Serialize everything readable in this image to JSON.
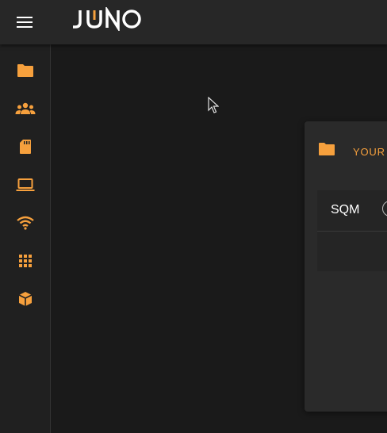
{
  "app": {
    "logo_text": "JUNO",
    "accent_color": "#f6a03d"
  },
  "sidebar": {
    "items": [
      {
        "icon": "folder-icon"
      },
      {
        "icon": "people-icon"
      },
      {
        "icon": "sd-card-icon"
      },
      {
        "icon": "laptop-icon"
      },
      {
        "icon": "wifi-icon"
      },
      {
        "icon": "apps-grid-icon"
      },
      {
        "icon": "package-icon"
      }
    ]
  },
  "card": {
    "title": "YOUR",
    "rows": [
      {
        "label": "SQM"
      }
    ]
  }
}
